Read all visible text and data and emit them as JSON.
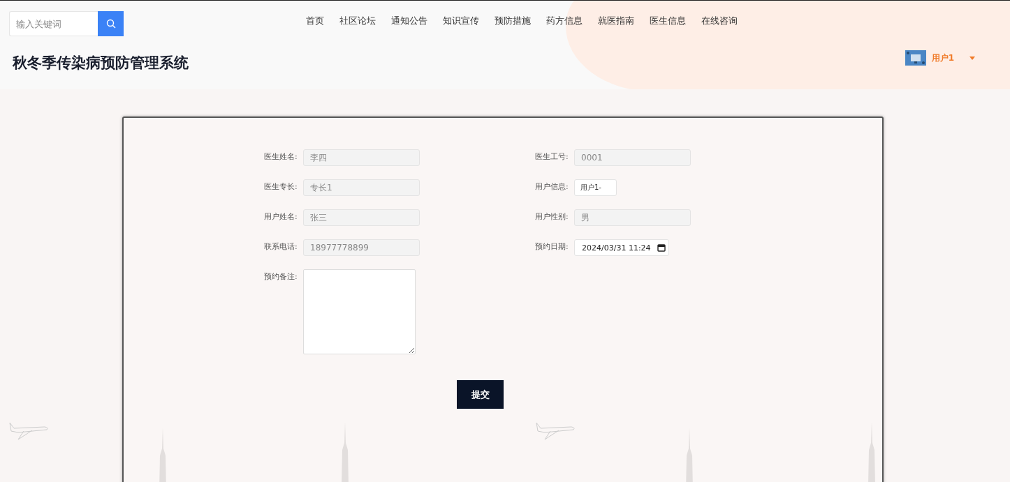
{
  "search": {
    "placeholder": "输入关键词"
  },
  "nav": [
    {
      "label": "首页"
    },
    {
      "label": "社区论坛"
    },
    {
      "label": "通知公告"
    },
    {
      "label": "知识宣传"
    },
    {
      "label": "预防措施"
    },
    {
      "label": "药方信息"
    },
    {
      "label": "就医指南"
    },
    {
      "label": "医生信息"
    },
    {
      "label": "在线咨询"
    }
  ],
  "site_title": "秋冬季传染病预防管理系统",
  "user": {
    "name": "用户1"
  },
  "form": {
    "fields": [
      {
        "label": "医生姓名:",
        "value": "李四",
        "kind": "text",
        "disabled": true
      },
      {
        "label": "医生工号:",
        "value": "0001",
        "kind": "text",
        "disabled": true
      },
      {
        "label": "医生专长:",
        "value": "专长1",
        "kind": "text",
        "disabled": true
      },
      {
        "label": "用户信息:",
        "value": "用户1-",
        "kind": "select",
        "disabled": false
      },
      {
        "label": "用户姓名:",
        "value": "张三",
        "kind": "text",
        "disabled": true
      },
      {
        "label": "用户性别:",
        "value": "男",
        "kind": "text",
        "disabled": true
      },
      {
        "label": "联系电话:",
        "value": "18977778899",
        "kind": "text",
        "disabled": true
      },
      {
        "label": "预约日期:",
        "value": "2024/03/31 11:24",
        "kind": "datetime",
        "disabled": false
      },
      {
        "label": "预约备注:",
        "kind": "textarea",
        "disabled": false
      }
    ],
    "submit": "提交"
  }
}
